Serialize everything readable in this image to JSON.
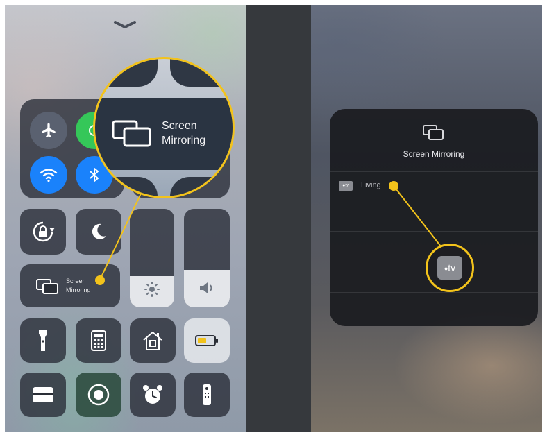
{
  "left_panel": {
    "connectivity": {
      "airplane": "airplane-icon",
      "cellular": "cellular-icon",
      "wifi": "wifi-icon",
      "bluetooth": "bluetooth-icon"
    },
    "screen_mirroring": {
      "label_line1": "Screen",
      "label_line2": "Mirroring"
    },
    "brightness_level": 0.32,
    "volume_level": 0.38
  },
  "zoom_callout": {
    "label_line1": "Screen",
    "label_line2": "Mirroring"
  },
  "right_panel": {
    "title": "Screen Mirroring",
    "devices": [
      {
        "badge": "tv",
        "name": "Living"
      }
    ],
    "apple_tv_callout": "tv"
  },
  "colors": {
    "accent_yellow": "#f3c31b",
    "airplane_orange": "#5a6170",
    "cellular_green": "#35c759",
    "wifi_blue": "#1a82fb",
    "bluetooth_blue": "#1a82fb",
    "tile_dark": "#2a2e36",
    "card_dark": "#1a1b1f"
  }
}
